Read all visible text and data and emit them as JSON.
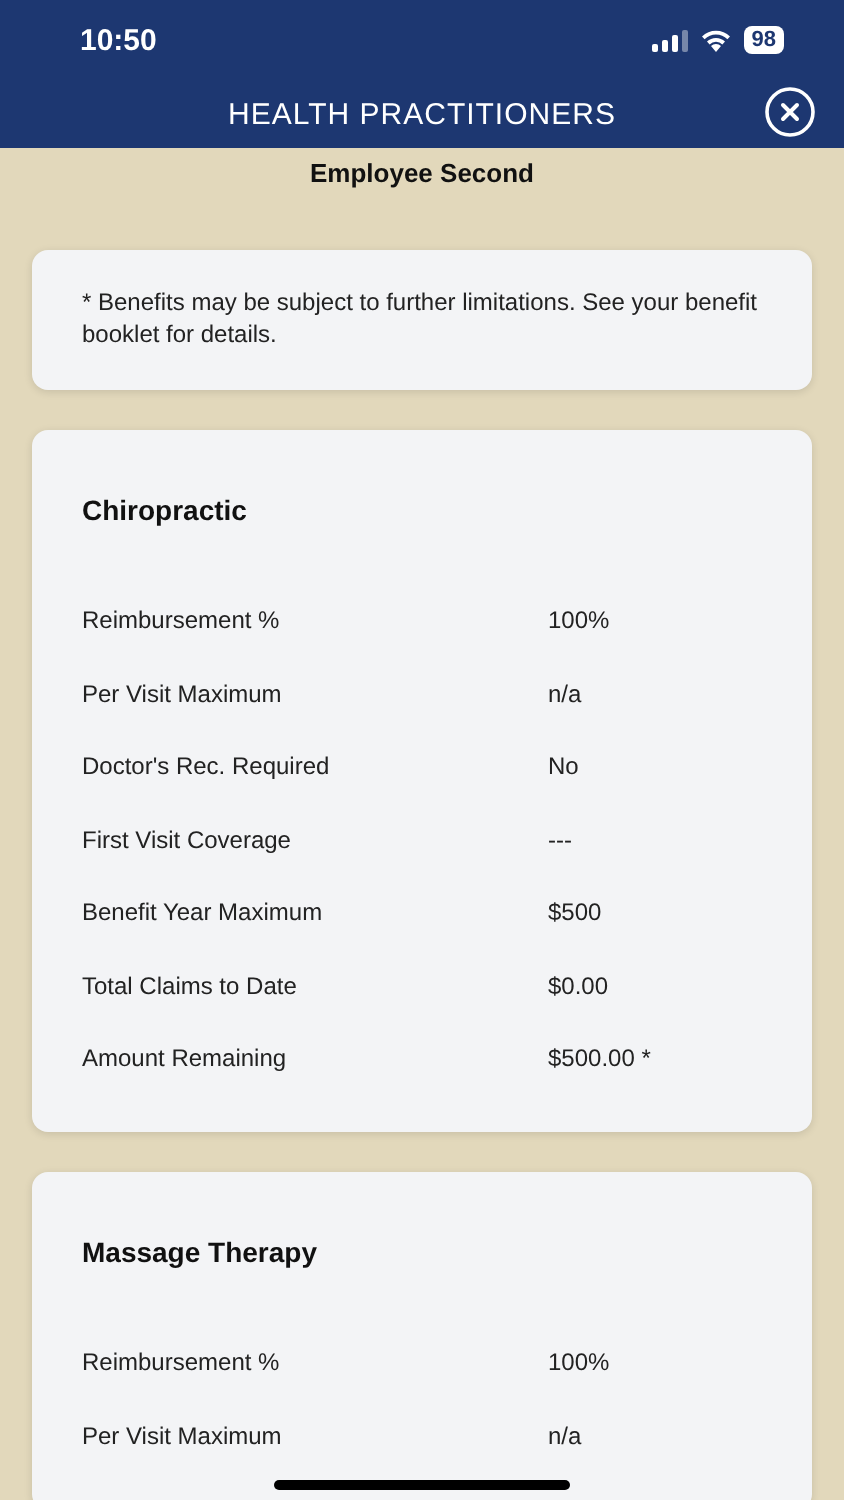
{
  "status_bar": {
    "time": "10:50",
    "battery": "98"
  },
  "header": {
    "title": "HEALTH PRACTITIONERS"
  },
  "subtitle": "Employee Second",
  "note": "* Benefits may be subject to further limitations. See your benefit booklet for details.",
  "benefits": [
    {
      "title": "Chiropractic",
      "rows": [
        {
          "label": "Reimbursement %",
          "value": "100%"
        },
        {
          "label": "Per Visit Maximum",
          "value": "n/a"
        },
        {
          "label": "Doctor's Rec. Required",
          "value": "No"
        },
        {
          "label": "First Visit Coverage",
          "value": "---"
        },
        {
          "label": "Benefit Year Maximum",
          "value": "$500"
        },
        {
          "label": "Total Claims to Date",
          "value": "$0.00"
        },
        {
          "label": "Amount Remaining",
          "value": "$500.00 *"
        }
      ]
    },
    {
      "title": "Massage Therapy",
      "rows": [
        {
          "label": "Reimbursement %",
          "value": "100%"
        },
        {
          "label": "Per Visit Maximum",
          "value": "n/a"
        }
      ]
    }
  ]
}
